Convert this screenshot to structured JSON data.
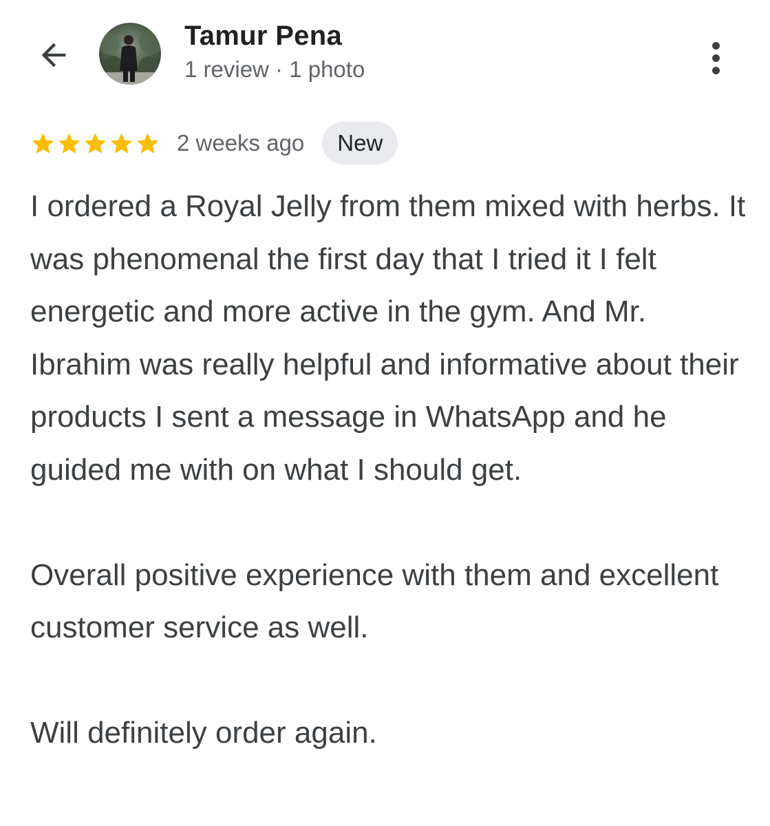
{
  "header": {
    "back_icon": "arrow-left-icon",
    "reviewer_name": "Tamur Pena",
    "reviewer_meta": "1 review · 1 photo",
    "more_icon": "more-vertical-icon"
  },
  "rating": {
    "stars": 5,
    "max_stars": 5,
    "star_color": "#fbbc04",
    "time": "2 weeks ago",
    "badge": "New"
  },
  "review": {
    "paragraph_1": "I ordered a Royal Jelly from them mixed with herbs. It was phenomenal the first day that I tried it I felt energetic and more active in the gym. And Mr. Ibrahim was really helpful and informative about their products I sent a message in WhatsApp and he guided me with on what I should get.",
    "paragraph_2": "Overall positive experience with them and excellent customer service as well.",
    "paragraph_3": "Will definitely order again."
  }
}
